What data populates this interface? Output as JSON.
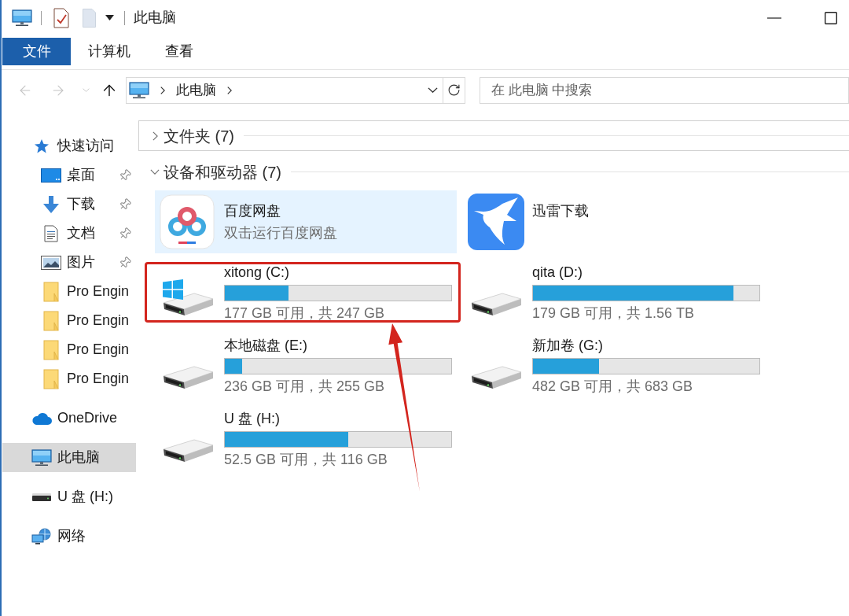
{
  "window": {
    "title": "此电脑"
  },
  "file_menu": {
    "label": "文件"
  },
  "ribbon_tabs": [
    {
      "label": "计算机"
    },
    {
      "label": "查看"
    }
  ],
  "navigation": [
    {
      "kind": "back",
      "disabled": true
    },
    {
      "kind": "forward",
      "disabled": true
    },
    {
      "kind": "recent",
      "disabled": true
    },
    {
      "kind": "up",
      "disabled": false
    }
  ],
  "address_bar": {
    "path": [
      "此电脑"
    ]
  },
  "search": {
    "placeholder": "在 此电脑 中搜索"
  },
  "sidebar": {
    "items": [
      {
        "kind": "quick-access",
        "label": "快速访问",
        "selected": false,
        "children": [
          {
            "kind": "desktop",
            "label": "桌面",
            "pinned": true,
            "selected": false
          },
          {
            "kind": "downloads",
            "label": "下载",
            "pinned": true,
            "selected": false
          },
          {
            "kind": "documents",
            "label": "文档",
            "pinned": true,
            "selected": false
          },
          {
            "kind": "pictures",
            "label": "图片",
            "pinned": true,
            "selected": false
          },
          {
            "kind": "folder",
            "label": "Pro Engin",
            "pinned": false,
            "selected": false
          },
          {
            "kind": "folder",
            "label": "Pro Engin",
            "pinned": false,
            "selected": false
          },
          {
            "kind": "folder",
            "label": "Pro Engin",
            "pinned": false,
            "selected": false
          },
          {
            "kind": "folder",
            "label": "Pro Engin",
            "pinned": false,
            "selected": false
          }
        ]
      },
      {
        "kind": "onedrive",
        "label": "OneDrive",
        "selected": false
      },
      {
        "kind": "this-pc",
        "label": "此电脑",
        "selected": true
      },
      {
        "kind": "usb-drive",
        "label": "U 盘 (H:)",
        "selected": false
      },
      {
        "kind": "network",
        "label": "网络",
        "selected": false
      }
    ]
  },
  "groups": [
    {
      "title": "文件夹 (7)",
      "expanded": false,
      "focused": true
    },
    {
      "title": "设备和驱动器 (7)",
      "expanded": true,
      "focused": false,
      "items": [
        {
          "kind": "netdisk-app",
          "name": "百度网盘",
          "description": "双击运行百度网盘",
          "selected": true
        },
        {
          "kind": "download-app",
          "name": "迅雷下载",
          "selected": false
        },
        {
          "kind": "drive",
          "name": "xitong (C:)",
          "level": 0.28,
          "usage": "177 GB 可用，共 247 GB",
          "system": true,
          "selected": false,
          "annotated": true
        },
        {
          "kind": "drive",
          "name": "qita (D:)",
          "level": 0.885,
          "usage": "179 GB 可用，共 1.56 TB",
          "system": false,
          "selected": false,
          "annotated": false
        },
        {
          "kind": "drive",
          "name": "本地磁盘 (E:)",
          "level": 0.075,
          "usage": "236 GB 可用，共 255 GB",
          "system": false,
          "selected": false,
          "annotated": false
        },
        {
          "kind": "drive",
          "name": "新加卷 (G:)",
          "level": 0.29,
          "usage": "482 GB 可用，共 683 GB",
          "system": false,
          "selected": false,
          "annotated": false
        },
        {
          "kind": "drive",
          "name": "U 盘 (H:)",
          "level": 0.545,
          "usage": "52.5 GB 可用，共 116 GB",
          "system": false,
          "selected": false,
          "annotated": false
        }
      ]
    }
  ]
}
